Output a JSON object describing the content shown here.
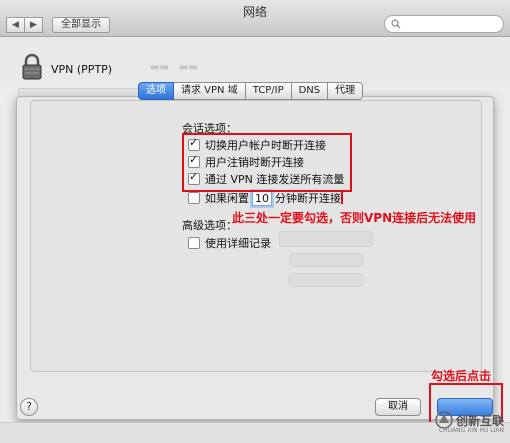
{
  "window": {
    "title": "网络"
  },
  "toolbar": {
    "back": "◀",
    "forward": "▶",
    "show_all_label": "全部显示"
  },
  "header": {
    "vpn_name": "VPN (PPTP)"
  },
  "tabs": [
    {
      "label": "选项",
      "active": true
    },
    {
      "label": "请求 VPN 域",
      "active": false
    },
    {
      "label": "TCP/IP",
      "active": false
    },
    {
      "label": "DNS",
      "active": false
    },
    {
      "label": "代理",
      "active": false
    }
  ],
  "session_options": {
    "title": "会话选项：",
    "disconnect_on_switch": {
      "label": "切换用户帐户时断开连接",
      "checked": true
    },
    "disconnect_on_logout": {
      "label": "用户注销时断开连接",
      "checked": true
    },
    "send_all_traffic": {
      "label": "通过 VPN 连接发送所有流量",
      "checked": true
    },
    "idle": {
      "label_before": "如果闲置",
      "minutes": "10",
      "label_after": "分钟断开连接",
      "checked": false
    }
  },
  "advanced_options": {
    "title": "高级选项：",
    "verbose_logging": {
      "label": "使用详细记录",
      "checked": false
    }
  },
  "annotations": {
    "must_check": "此三处一定要勾选，否则VPN连接后无法使用",
    "click_after": "勾选后点击"
  },
  "buttons": {
    "help": "?",
    "cancel": "取消"
  },
  "watermark": {
    "text": "创新互联",
    "subtext": "CHUANG XIN HU LIAN"
  },
  "colors": {
    "annotation_red": "#e0101a",
    "tab_active": "#3a7fe0"
  }
}
